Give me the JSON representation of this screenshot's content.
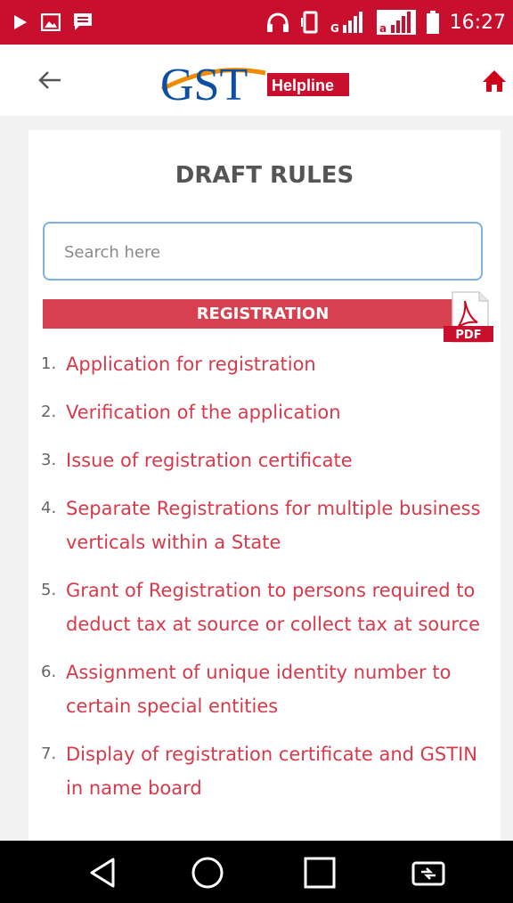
{
  "status_bar": {
    "time": "16:27",
    "icons": [
      "play-icon",
      "image-icon",
      "message-icon",
      "headphones-icon",
      "vibrate-icon",
      "signal-icon",
      "signal-icon",
      "battery-icon"
    ]
  },
  "app_bar": {
    "logo": {
      "text": "GST",
      "badge": "Helpline"
    },
    "icons": [
      "back-arrow-icon",
      "home-icon"
    ]
  },
  "page": {
    "title": "DRAFT RULES",
    "search": {
      "placeholder": "Search here",
      "value": ""
    },
    "section": {
      "label": "REGISTRATION",
      "pdf_badge": "PDF"
    }
  },
  "rules": [
    {
      "number": "1.",
      "text": "Application for registration"
    },
    {
      "number": "2.",
      "text": "Verification of the application"
    },
    {
      "number": "3.",
      "text": "Issue of registration certificate"
    },
    {
      "number": "4.",
      "text": "Separate Registrations for multiple business verticals within a State"
    },
    {
      "number": "5.",
      "text": "Grant of Registration to persons required to deduct tax at source or collect tax at source"
    },
    {
      "number": "6.",
      "text": "Assignment of unique identity number to certain special entities"
    },
    {
      "number": "7.",
      "text": "Display of registration certificate and GSTIN in name board"
    }
  ],
  "nav_bar": {
    "icons": [
      "back-triangle-icon",
      "home-circle-icon",
      "recents-square-icon",
      "screen-switch-icon"
    ]
  },
  "colors": {
    "status_bar": "#c8102e",
    "section_bar": "#d6404f",
    "link": "#d63a4b",
    "search_border": "#7cb1e3"
  }
}
